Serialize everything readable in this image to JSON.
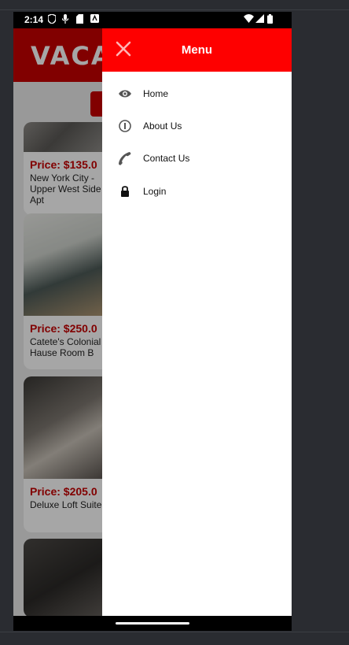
{
  "status_bar": {
    "time": "2:14"
  },
  "app": {
    "logo": "VACAN",
    "listings": [
      {
        "price": "Price: $135.0",
        "name": "New York City - Upper West Side Apt"
      },
      {
        "price": "Price: $250.0",
        "name": "Catete's Colonial Hause Room B"
      },
      {
        "price": "Price: $205.0",
        "name": "Deluxe Loft Suite"
      },
      {
        "price": "",
        "name": ""
      }
    ]
  },
  "drawer": {
    "title": "Menu",
    "close_icon": "close-icon",
    "items": [
      {
        "label": "Home",
        "icon": "eye-icon"
      },
      {
        "label": "About Us",
        "icon": "info-icon"
      },
      {
        "label": "Contact Us",
        "icon": "phone-icon"
      },
      {
        "label": "Login",
        "icon": "lock-icon"
      }
    ]
  },
  "colors": {
    "brand_red": "#fe0000",
    "header_red": "#c70000"
  }
}
